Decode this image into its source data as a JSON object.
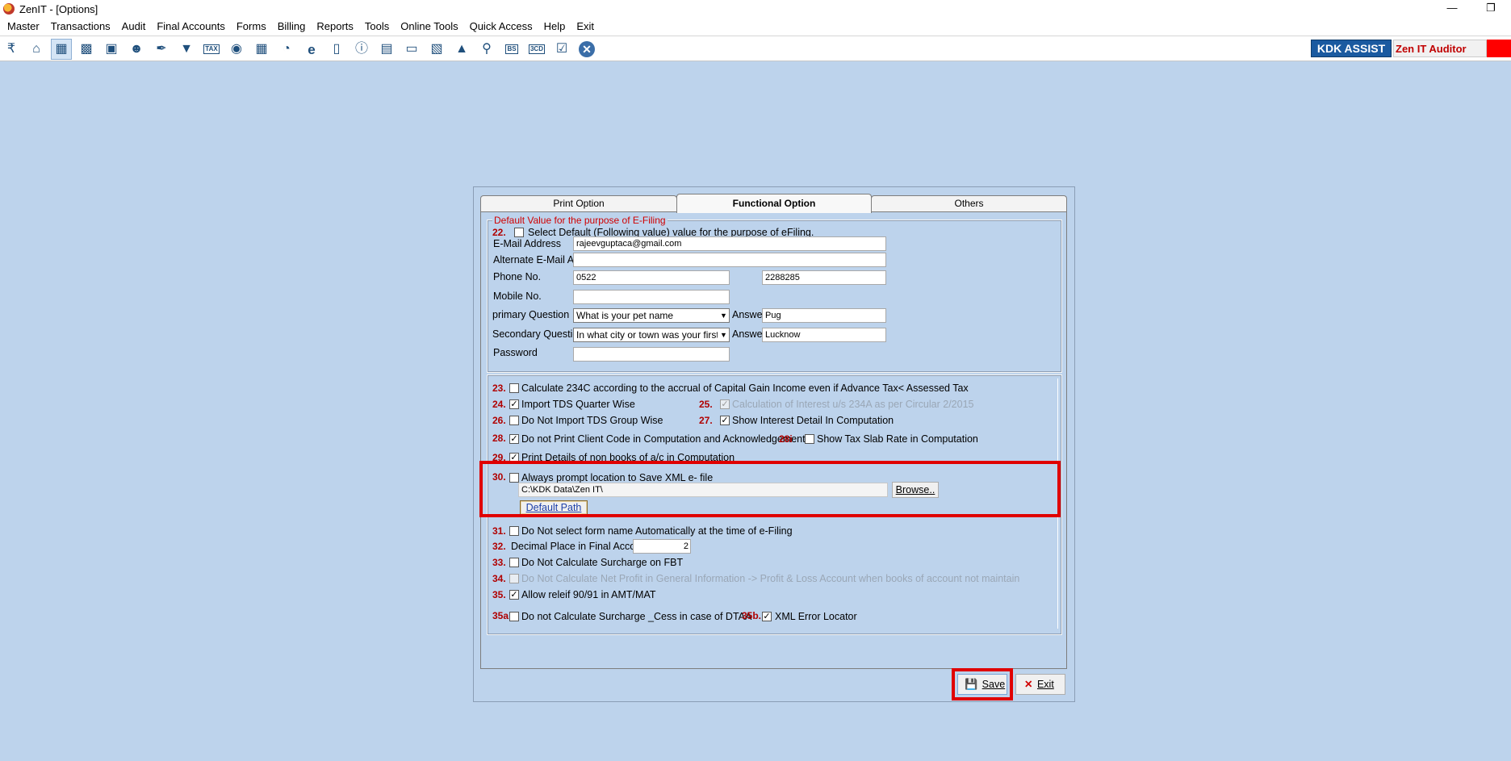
{
  "window": {
    "title": "ZenIT - [Options]"
  },
  "menu": [
    "Master",
    "Transactions",
    "Audit",
    "Final Accounts",
    "Forms",
    "Billing",
    "Reports",
    "Tools",
    "Online Tools",
    "Quick Access",
    "Help",
    "Exit"
  ],
  "toolbar": {
    "icons": [
      "rupee-icon",
      "home-icon",
      "calculator-icon",
      "bar-chart-icon",
      "gift-icon",
      "users-icon",
      "pin-icon",
      "filter-download-icon",
      "tax-icon",
      "eye-icon",
      "grid-icon",
      "pie-icon",
      "epay-icon",
      "book-icon",
      "info-icon",
      "report-icon",
      "user-doc-icon",
      "calendar-icon",
      "upload-icon",
      "search-doc-icon",
      "bs-icon",
      "3cd-icon",
      "doc-check-icon",
      "close-circle-icon"
    ],
    "icon_texts": {
      "tax-icon": "TAX",
      "bs-icon": "BS",
      "3cd-icon": "3CD",
      "epay-icon": "e"
    },
    "kdk_assist": "KDK ASSIST",
    "auditor": "Zen IT Auditor"
  },
  "tabs": [
    {
      "label": "Print Option",
      "active": false
    },
    {
      "label": "Functional Option",
      "active": true
    },
    {
      "label": "Others",
      "active": false
    }
  ],
  "efiling": {
    "legend": "Default Value for the purpose of E-Filing",
    "opt22": {
      "num": "22.",
      "label": "Select Default (Following value) value for the purpose of eFiling.",
      "checked": false
    },
    "email_label": "E-Mail Address",
    "email_value": "rajeevguptaca@gmail.com",
    "alt_email_label": "Alternate E-Mail Add.",
    "alt_email_value": "",
    "phone_label": "Phone No.",
    "phone_std": "0522",
    "phone_number": "2288285",
    "mobile_label": "Mobile No.",
    "mobile_value": "",
    "primary_q_label": "primary Question",
    "primary_q_value": "What is your pet name",
    "answer_label": "Answer",
    "primary_answer": "Pug",
    "secondary_q_label": "Secondary Question",
    "secondary_q_value": "In what city or town was your first jo",
    "secondary_answer": "Lucknow",
    "password_label": "Password",
    "password_value": ""
  },
  "options": {
    "o23": {
      "num": "23.",
      "label": "Calculate 234C according to the accrual of Capital Gain Income even if Advance Tax< Assessed Tax",
      "checked": false
    },
    "o24": {
      "num": "24.",
      "label": "Import TDS Quarter Wise",
      "checked": true
    },
    "o25": {
      "num": "25.",
      "label": "Calculation of Interest u/s 234A as per Circular 2/2015",
      "checked": true,
      "disabled": true
    },
    "o26": {
      "num": "26.",
      "label": "Do Not Import TDS Group Wise",
      "checked": false
    },
    "o27": {
      "num": "27.",
      "label": "Show Interest Detail In Computation",
      "checked": true
    },
    "o28": {
      "num": "28.",
      "label": "Do not Print Client Code in Computation and Acknowledgement",
      "checked": true
    },
    "o28i": {
      "num": "28i",
      "label": "Show Tax Slab Rate in Computation",
      "checked": false
    },
    "o29": {
      "num": "29.",
      "label": "Print Details of non books of a/c in Computation",
      "checked": true
    },
    "o30": {
      "num": "30.",
      "label": "Always prompt location to Save XML e- file",
      "checked": false,
      "path": "C:\\KDK Data\\Zen IT\\",
      "browse": "Browse..",
      "default_path": "Default Path"
    },
    "o31": {
      "num": "31.",
      "label": "Do Not select form name Automatically at the time of e-Filing",
      "checked": false
    },
    "o32": {
      "num": "32.",
      "label": "Decimal Place in Final Account",
      "value": "2"
    },
    "o33": {
      "num": "33.",
      "label": "Do Not Calculate Surcharge on FBT",
      "checked": false
    },
    "o34": {
      "num": "34.",
      "label": "Do Not  Calculate Net Profit in General Information -> Profit & Loss Account when books of account not maintain",
      "checked": false,
      "disabled": true
    },
    "o35": {
      "num": "35.",
      "label": "Allow releif 90/91 in AMT/MAT",
      "checked": true
    },
    "o35a": {
      "num": "35a",
      "label": "Do not Calculate Surcharge _Cess in case of DTAA",
      "checked": false
    },
    "o35b": {
      "num": "35b.",
      "label": "XML Error Locator",
      "checked": true
    }
  },
  "buttons": {
    "save": "Save",
    "exit": "Exit"
  },
  "colors": {
    "background": "#bdd3ec",
    "accent_red": "#e00000",
    "number_red": "#b00000",
    "kdk_blue": "#1a5aa0"
  }
}
